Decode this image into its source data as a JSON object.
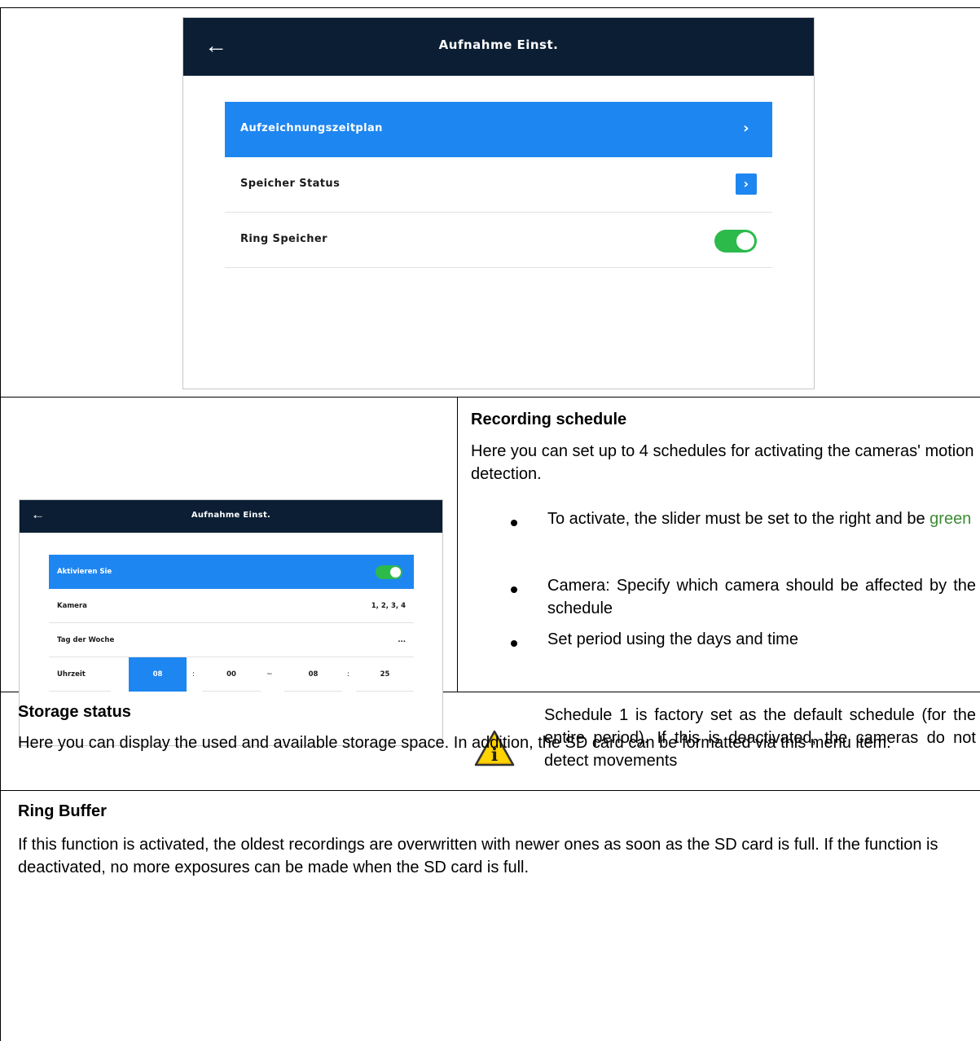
{
  "screen_main": {
    "title": "Aufnahme Einst.",
    "back_icon": "←",
    "items": [
      {
        "label": "Aufzeichnungszeitplan",
        "chevron": "›"
      },
      {
        "label": "Speicher Status",
        "chevron": "›"
      },
      {
        "label": "Ring Speicher",
        "toggle_on": true
      }
    ]
  },
  "screen_schedule": {
    "title": "Aufnahme Einst.",
    "back_icon": "←",
    "rows": [
      {
        "label": "Aktivieren Sie",
        "toggle_on": true
      },
      {
        "label": "Kamera",
        "value": "1, 2, 3, 4"
      },
      {
        "label": "Tag der Woche",
        "value": "..."
      },
      {
        "label": "Uhrzeit"
      }
    ],
    "time": {
      "start_h": "08",
      "sep1": ":",
      "start_m": "00",
      "tilde": "~",
      "end_h": "08",
      "sep2": ":",
      "end_m": "25"
    }
  },
  "sections": {
    "recording": {
      "heading": "Recording schedule",
      "intro": "Here you can set up to 4 schedules for activating the cameras' motion detection.",
      "bullets": [
        {
          "text": "To activate, the slider must be set to the right and be ",
          "emph": "green"
        },
        {
          "text": "Camera: Specify which camera should be affected by the schedule"
        },
        {
          "text": "Set period using the days and time"
        }
      ],
      "note": "Schedule 1 is factory set as the default schedule (for the entire period). If this is deactivated, the cameras do not detect movements",
      "note_icon": "info-warning-icon",
      "note_icon_glyph": "i"
    },
    "storage": {
      "heading": "Storage status",
      "text": "Here you can display the used and available storage space. In addition, the SD card can be formatted via this menu item."
    },
    "ring": {
      "heading": "Ring Buffer",
      "text": "If this function is activated, the oldest recordings are overwritten with newer ones as soon as the SD card is full. If the function is deactivated, no more exposures can be made when the SD card is full."
    }
  },
  "colors": {
    "header": "#0b1e33",
    "accent": "#1e86f0",
    "toggle": "#2cba4b",
    "emph_green": "#3d8c35"
  }
}
